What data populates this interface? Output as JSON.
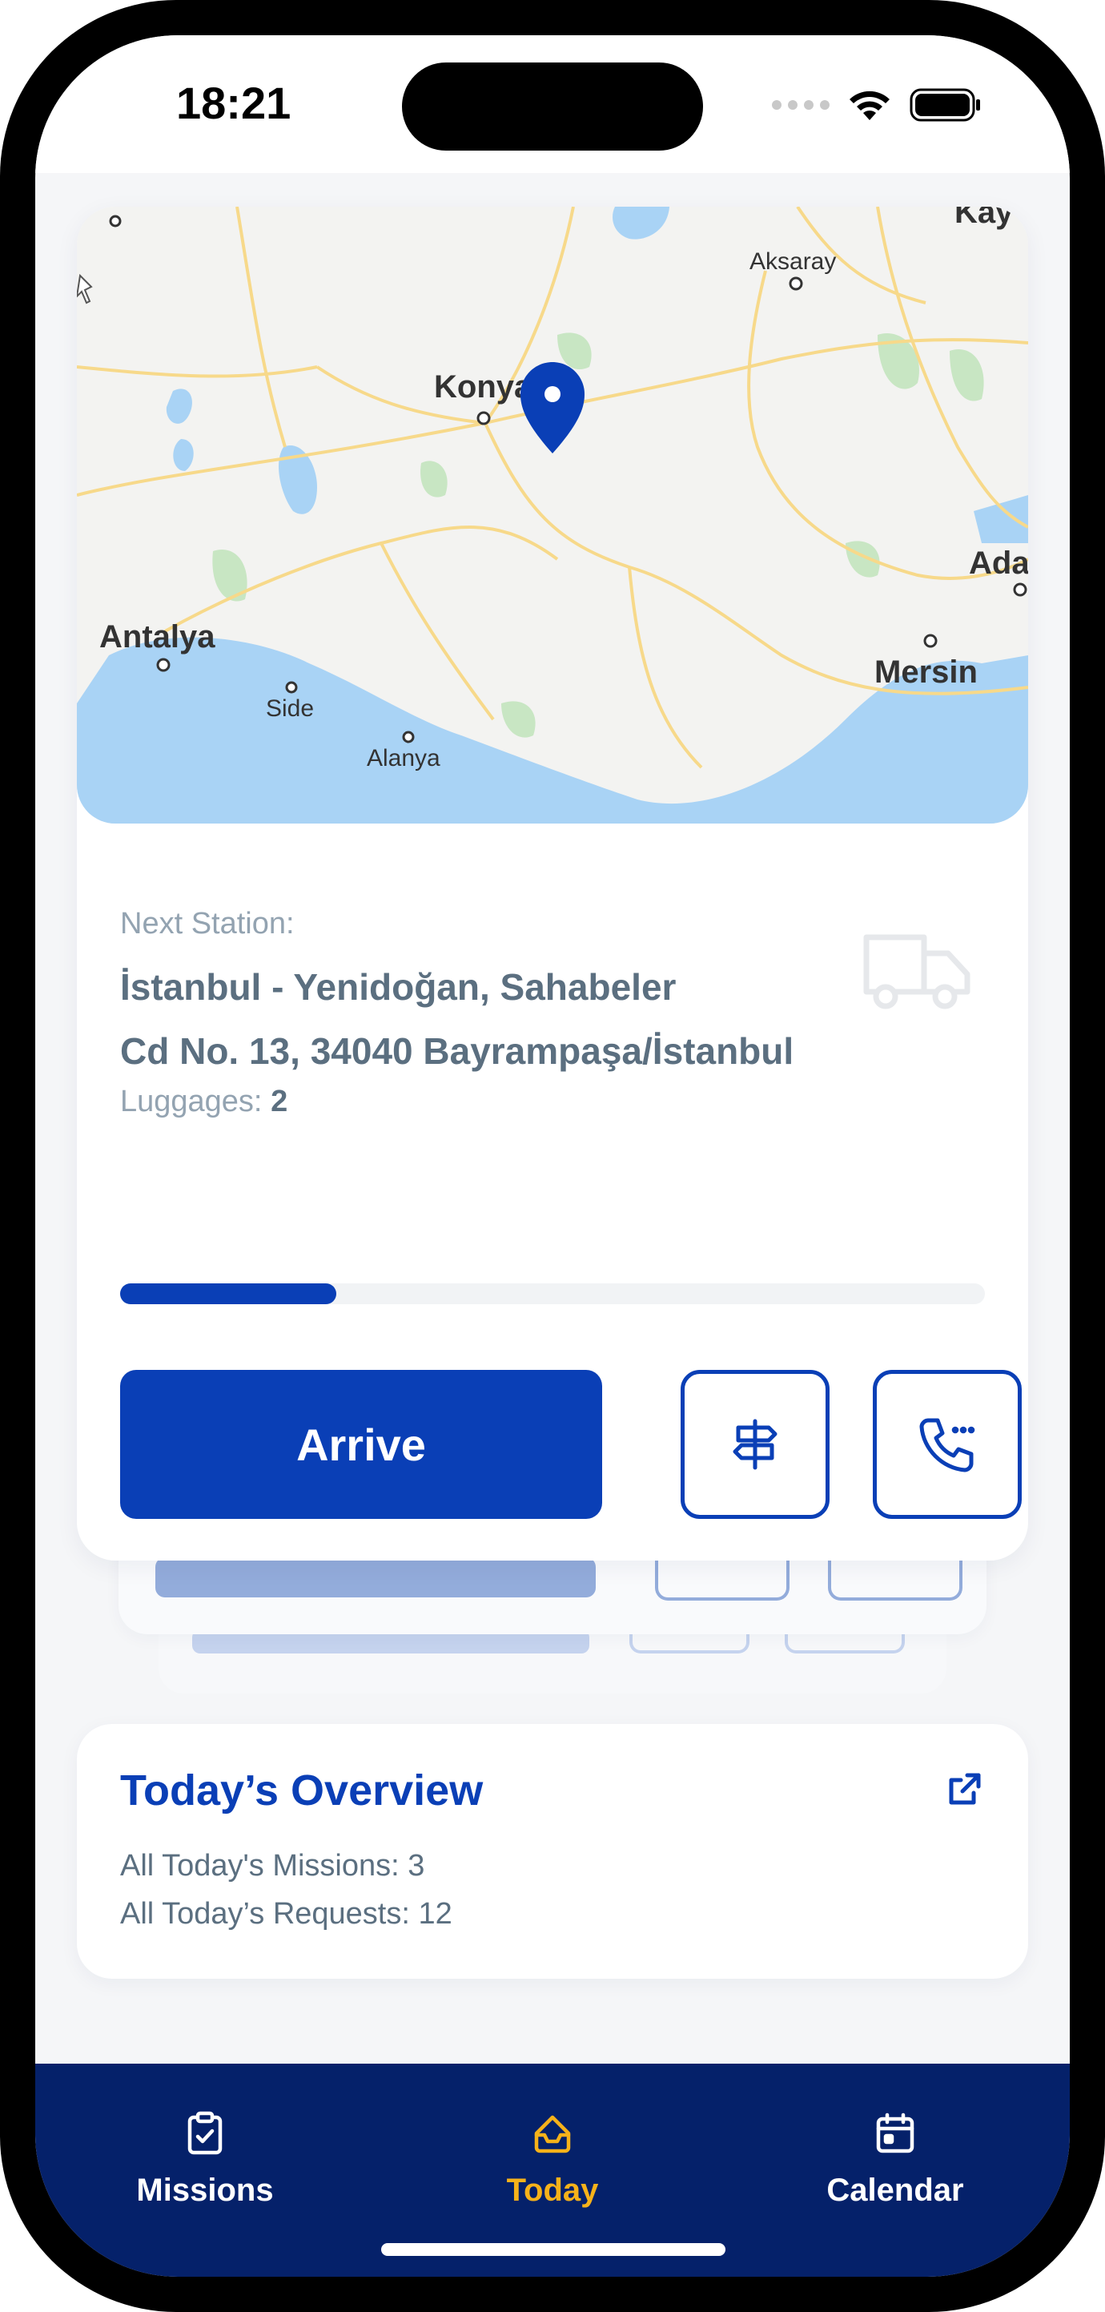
{
  "status_bar": {
    "time": "18:21"
  },
  "map": {
    "labels": {
      "konya": "Konya",
      "aksaray": "Aksaray",
      "kay": "Kay",
      "antalya": "Antalya",
      "side": "Side",
      "alanya": "Alanya",
      "mersin": "Mersin",
      "ada": "Ada"
    }
  },
  "mission": {
    "next_station_label": "Next Station:",
    "address_line1": "İstanbul - Yenidoğan, Sahabeler",
    "address_line2": "Cd No. 13, 34040 Bayrampaşa/İstanbul",
    "luggage_label": "Luggages:",
    "luggage_count": "2",
    "progress": 0.25,
    "arrive_label": "Arrive"
  },
  "overview": {
    "title": "Today’s Overview",
    "missions_line": "All Today's Missions: 3",
    "requests_line": "All Today’s Requests: 12"
  },
  "nav": {
    "items": [
      {
        "label": "Missions",
        "icon": "clipboard-check-icon"
      },
      {
        "label": "Today",
        "icon": "inbox-icon",
        "active": true
      },
      {
        "label": "Calendar",
        "icon": "calendar-icon"
      }
    ]
  },
  "colors": {
    "primary": "#0a3fb6",
    "nav_bg": "#05216a",
    "active": "#f6b21a",
    "text_muted": "#93a3b1",
    "text_main": "#5b6f80"
  }
}
